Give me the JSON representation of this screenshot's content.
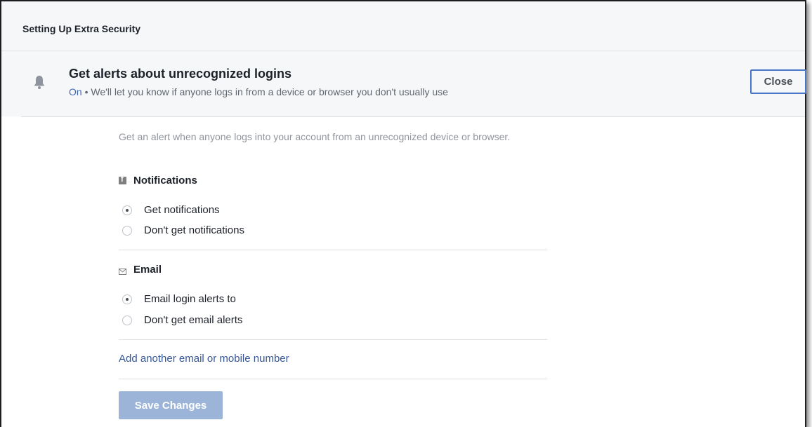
{
  "panel": {
    "title": "Setting Up Extra Security"
  },
  "alert": {
    "icon": "bell-icon",
    "title": "Get alerts about unrecognized logins",
    "status": "On",
    "status_separator": " • ",
    "status_description": "We'll let you know if anyone logs in from a device or browser you don't usually use",
    "close_label": "Close"
  },
  "settings": {
    "description": "Get an alert when anyone logs into your account from an unrecognized device or browser.",
    "notifications": {
      "icon": "facebook-icon",
      "heading": "Notifications",
      "options": [
        {
          "label": "Get notifications",
          "checked": true
        },
        {
          "label": "Don't get notifications",
          "checked": false
        }
      ]
    },
    "email": {
      "icon": "envelope-icon",
      "heading": "Email",
      "options": [
        {
          "label": "Email login alerts to",
          "checked": true
        },
        {
          "label": "Don't get email alerts",
          "checked": false
        }
      ]
    },
    "add_link": "Add another email or mobile number",
    "save_label": "Save Changes"
  },
  "colors": {
    "link": "#365899",
    "status_on": "#4267b2",
    "save_disabled": "#9cb4d8",
    "close_border": "#4a76c8"
  }
}
